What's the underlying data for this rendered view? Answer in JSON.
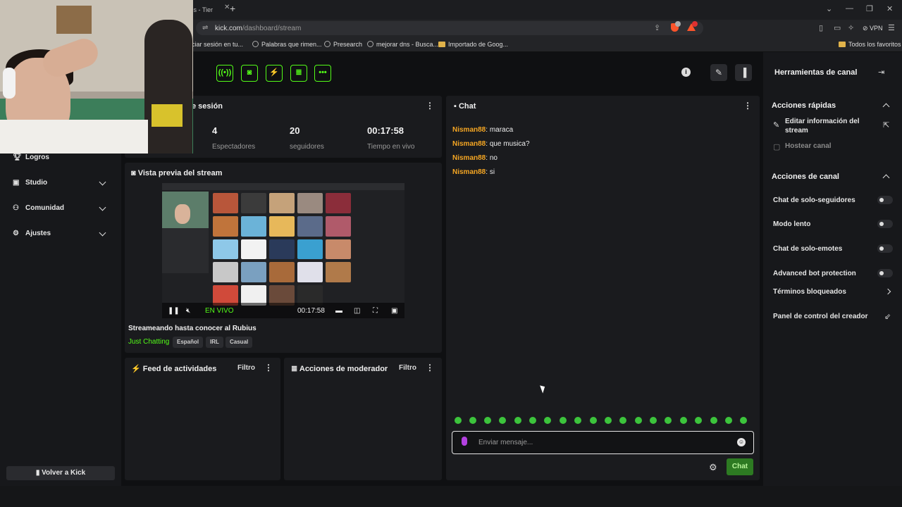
{
  "browser": {
    "tab_title": "ates - Tier",
    "url_domain": "kick.com",
    "url_path": "/dashboard/stream",
    "vpn_label": "VPN",
    "bookmarks": [
      "iciar sesión en tu...",
      "Palabras que rimen...",
      "Presearch",
      "mejorar dns - Busca...",
      "Importado de Goog..."
    ],
    "all_favorites": "Todos los favoritos"
  },
  "sidebar": {
    "items": [
      {
        "label": "Logros",
        "icon": "trophy-icon"
      },
      {
        "label": "Studio",
        "icon": "studio-icon"
      },
      {
        "label": "Comunidad",
        "icon": "users-icon"
      },
      {
        "label": "Ajustes",
        "icon": "gear-icon"
      }
    ],
    "back_label": "Volver a Kick"
  },
  "session": {
    "title_fragment": "e sesión",
    "stats": [
      {
        "value": "4",
        "label": "Espectadores"
      },
      {
        "value": "20",
        "label": "seguidores"
      },
      {
        "value": "00:17:58",
        "label": "Tiempo en vivo"
      }
    ]
  },
  "preview": {
    "title": "Vista previa del stream",
    "live_label": "EN VIVO",
    "time": "00:17:58",
    "stream_title": "Streameando hasta conocer al Rubius",
    "category": "Just Chatting",
    "tags": [
      "Español",
      "IRL",
      "Casual"
    ]
  },
  "activity": {
    "title": "Feed de actividades",
    "filter": "Filtro"
  },
  "moderator": {
    "title": "Acciones de moderador",
    "filter": "Filtro"
  },
  "chat": {
    "title": "Chat",
    "messages": [
      {
        "user": "Nisman88",
        "text": "maraca"
      },
      {
        "user": "Nisman88",
        "text": "que musica?"
      },
      {
        "user": "Nisman88",
        "text": "no"
      },
      {
        "user": "Nisman88",
        "text": "si"
      }
    ],
    "placeholder": "Enviar mensaje...",
    "send_label": "Chat"
  },
  "right_panel": {
    "title": "Herramientas de canal",
    "quick_actions_title": "Acciones rápidas",
    "edit_info_line1": "Editar información del",
    "edit_info_line2": "stream",
    "host_channel": "Hostear canal",
    "channel_actions_title": "Acciones de canal",
    "toggles": [
      {
        "label": "Chat de solo-seguidores",
        "enabled": false
      },
      {
        "label": "Modo lento",
        "enabled": false
      },
      {
        "label": "Chat de solo-emotes",
        "enabled": false
      },
      {
        "label": "Advanced bot protection",
        "enabled": false
      }
    ],
    "blocked_terms": "Términos bloqueados",
    "creator_panel": "Panel de control del creador"
  },
  "colors": {
    "accent": "#53fc18",
    "username": "#f5a623",
    "background": "#0f1012"
  }
}
